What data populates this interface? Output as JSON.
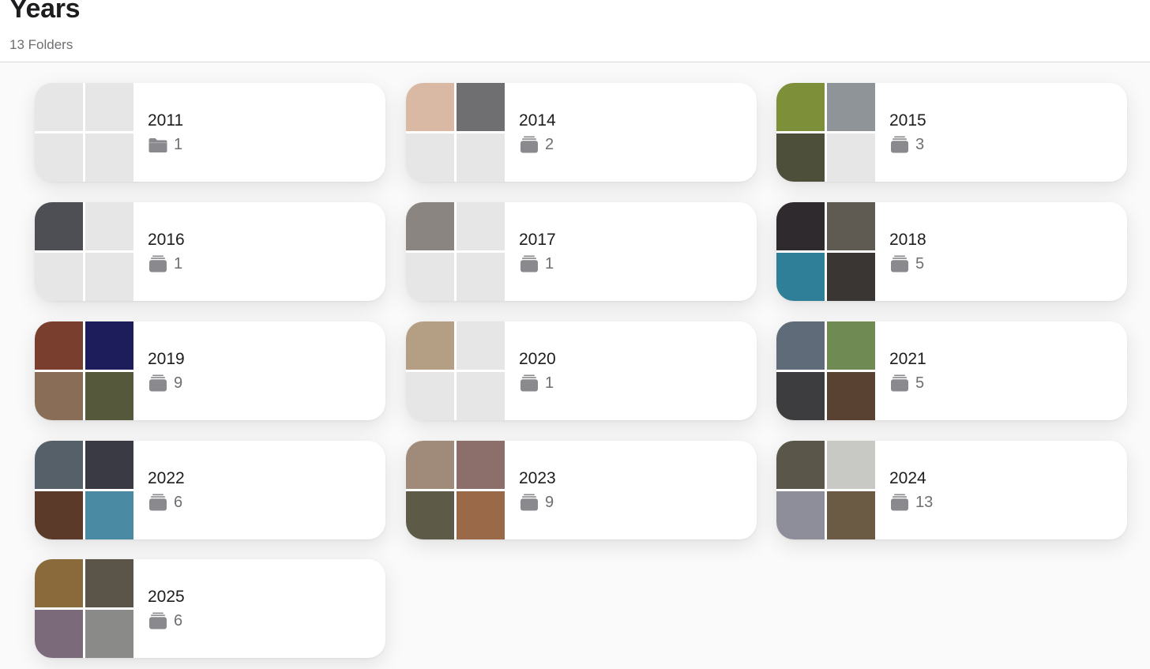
{
  "header": {
    "title": "Years",
    "subtitle": "13 Folders"
  },
  "folders": [
    {
      "year": "2011",
      "count": "1",
      "icon": "folder-icon",
      "tiles": [
        "#e6e6e6",
        "#e6e6e6",
        "#e6e6e6",
        "#e6e6e6"
      ]
    },
    {
      "year": "2014",
      "count": "2",
      "icon": "stack-icon",
      "tiles": [
        "#d9b9a4",
        "#6f6e70",
        "#e6e6e6",
        "#e6e6e6"
      ]
    },
    {
      "year": "2015",
      "count": "3",
      "icon": "stack-icon",
      "tiles": [
        "#7e8f3a",
        "#8e9498",
        "#4d4f3b",
        "#e6e6e6"
      ]
    },
    {
      "year": "2016",
      "count": "1",
      "icon": "stack-icon",
      "tiles": [
        "#4d4f55",
        "#e6e6e6",
        "#e6e6e6",
        "#e6e6e6"
      ]
    },
    {
      "year": "2017",
      "count": "1",
      "icon": "stack-icon",
      "tiles": [
        "#8a8581",
        "#e6e6e6",
        "#e6e6e6",
        "#e6e6e6"
      ]
    },
    {
      "year": "2018",
      "count": "5",
      "icon": "stack-icon",
      "tiles": [
        "#2e2a2d",
        "#5f5a52",
        "#2f7f99",
        "#3a3633"
      ]
    },
    {
      "year": "2019",
      "count": "9",
      "icon": "stack-icon",
      "tiles": [
        "#7a3e2e",
        "#1c1d5a",
        "#8a6d56",
        "#55583a"
      ]
    },
    {
      "year": "2020",
      "count": "1",
      "icon": "stack-icon",
      "tiles": [
        "#b49f84",
        "#e6e6e6",
        "#e6e6e6",
        "#e6e6e6"
      ]
    },
    {
      "year": "2021",
      "count": "5",
      "icon": "stack-icon",
      "tiles": [
        "#5f6b78",
        "#6f8a52",
        "#3d3c3e",
        "#5a4232"
      ]
    },
    {
      "year": "2022",
      "count": "6",
      "icon": "stack-icon",
      "tiles": [
        "#566069",
        "#3a3a44",
        "#5b3a2a",
        "#4a8aa3"
      ]
    },
    {
      "year": "2023",
      "count": "9",
      "icon": "stack-icon",
      "tiles": [
        "#a08a7a",
        "#8c6f6a",
        "#5e5a48",
        "#9a6a48"
      ]
    },
    {
      "year": "2024",
      "count": "13",
      "icon": "stack-icon",
      "tiles": [
        "#5a5649",
        "#c8c8c4",
        "#8e8e9a",
        "#6b5a44"
      ]
    },
    {
      "year": "2025",
      "count": "6",
      "icon": "stack-icon",
      "tiles": [
        "#8a6a3a",
        "#5a5548",
        "#7a6a7a",
        "#8a8a88"
      ]
    }
  ]
}
